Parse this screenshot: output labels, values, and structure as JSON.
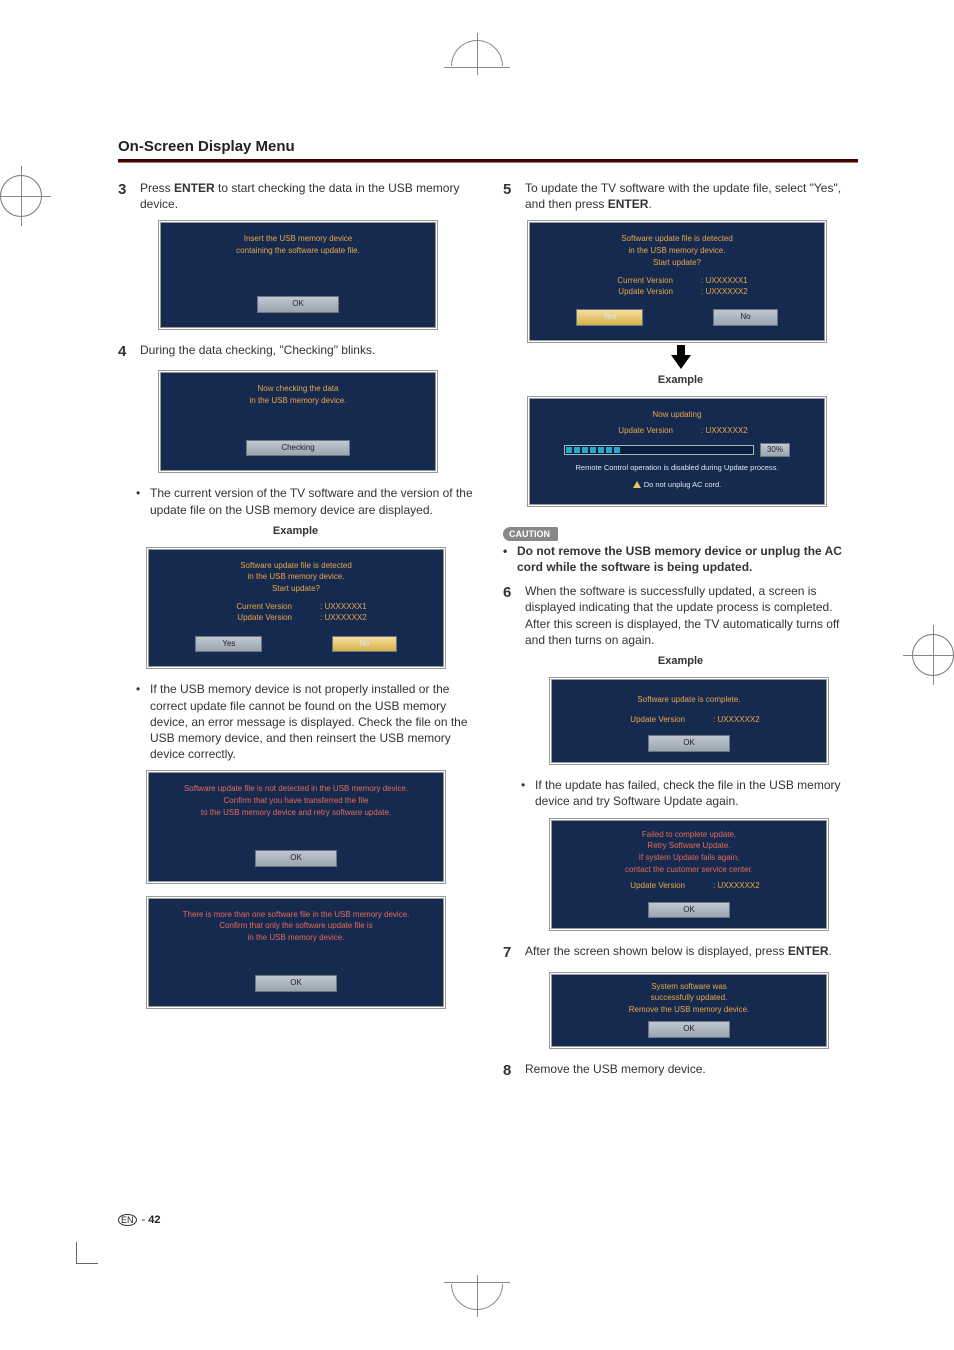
{
  "page": {
    "title": "On-Screen Display Menu",
    "number": "42",
    "lang_badge": "EN"
  },
  "left": {
    "step3": {
      "num": "3",
      "text_a": "Press ",
      "bold": "ENTER",
      "text_b": " to start checking the data in the USB memory device."
    },
    "scr1": {
      "l1": "Insert the USB memory device",
      "l2": "containing the software update file.",
      "ok": "OK"
    },
    "step4": {
      "num": "4",
      "text": "During the data checking, \"Checking\" blinks."
    },
    "scr2": {
      "l1": "Now checking the data",
      "l2": "in the USB memory device.",
      "ok": "Checking"
    },
    "bullet1": "The current version of the TV software and the version of the update file on the USB memory device are displayed.",
    "example1": "Example",
    "scr3": {
      "l1": "Software update file is detected",
      "l2": "in the USB memory device.",
      "l3": "Start update?",
      "cv_k": "Current Version",
      "cv_v": ":  UXXXXXX1",
      "uv_k": "Update Version",
      "uv_v": ":  UXXXXXX2",
      "yes": "Yes",
      "no": "No"
    },
    "bullet2": "If the USB memory device is not properly installed or the correct update file cannot be found on the USB memory device, an error message is displayed. Check the file on the USB memory device, and then reinsert the USB memory device correctly.",
    "scr4": {
      "l1": "Software update file is not detected in the USB memory device.",
      "l2": "Confirm that you have transferred the file",
      "l3": "to the USB memory device and retry software update.",
      "ok": "OK"
    },
    "scr5": {
      "l1": "There is more than one software file in the USB memory device.",
      "l2": "Confirm that only the software update file is",
      "l3": "in the USB memory device.",
      "ok": "OK"
    }
  },
  "right": {
    "step5": {
      "num": "5",
      "text_a": "To update the TV software with the update file, select \"Yes\", and then press ",
      "bold": "ENTER",
      "text_b": "."
    },
    "scr6": {
      "l1": "Software update file is detected",
      "l2": "in the USB memory device.",
      "l3": "Start update?",
      "cv_k": "Current Version",
      "cv_v": ":  UXXXXXX1",
      "uv_k": "Update Version",
      "uv_v": ":  UXXXXXX2",
      "yes": "Yes",
      "no": "No"
    },
    "example2": "Example",
    "scr7": {
      "title": "Now updating",
      "uv_k": "Update Version",
      "uv_v": ":  UXXXXXX2",
      "pct": "30%",
      "warn1": "Remote Control operation is disabled during Update process.",
      "warn2": "Do not unplug AC cord."
    },
    "caution_badge": "CAUTION",
    "caution": "Do not remove the USB memory device or unplug the AC cord while the software is being updated.",
    "step6": {
      "num": "6",
      "text": "When the software is successfully updated, a screen is displayed indicating that the update process is completed.",
      "text2": "After this screen is displayed, the TV automatically turns off and then turns on again."
    },
    "example3": "Example",
    "scr8": {
      "l1": "Software update is complete.",
      "uv_k": "Update Version",
      "uv_v": ":  UXXXXXX2",
      "ok": "OK"
    },
    "bullet3": "If the update has failed, check the file in the USB memory device and try Software Update again.",
    "scr9": {
      "l1": "Failed to complete update.",
      "l2": "Retry Software Update.",
      "l3": "If system Update fails again,",
      "l4": "contact the customer service center.",
      "uv_k": "Update Version",
      "uv_v": ":  UXXXXXX2",
      "ok": "OK"
    },
    "step7": {
      "num": "7",
      "text_a": "After the screen shown below is displayed, press ",
      "bold": "ENTER",
      "text_b": "."
    },
    "scr10": {
      "l1": "System software was",
      "l2": "successfully updated.",
      "l3": "Remove the USB memory device.",
      "ok": "OK"
    },
    "step8": {
      "num": "8",
      "text": "Remove the USB memory device."
    }
  }
}
